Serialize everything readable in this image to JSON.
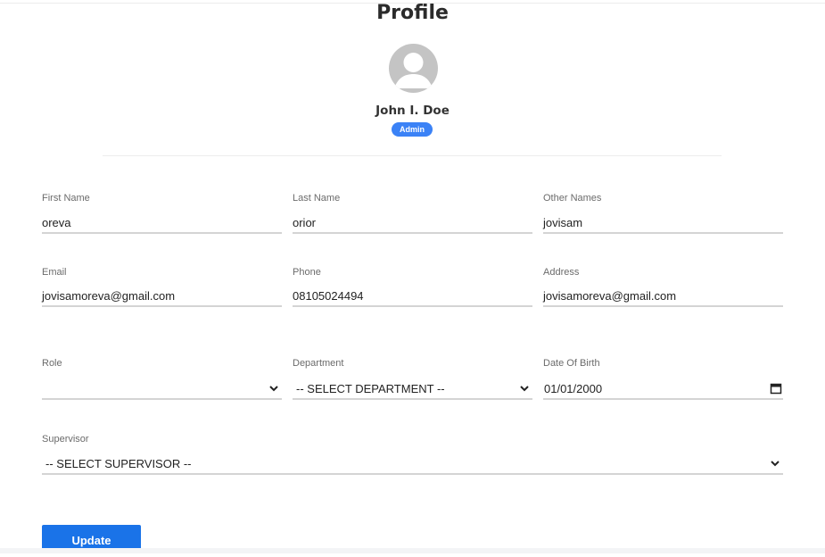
{
  "page": {
    "title": "Profile"
  },
  "profile": {
    "name": "John I. Doe",
    "role_badge": "Admin"
  },
  "form": {
    "first_name": {
      "label": "First Name",
      "value": "oreva"
    },
    "last_name": {
      "label": "Last Name",
      "value": "orior"
    },
    "other_names": {
      "label": "Other Names",
      "value": "jovisam"
    },
    "email": {
      "label": "Email",
      "value": "jovisamoreva@gmail.com"
    },
    "phone": {
      "label": "Phone",
      "value": "08105024494"
    },
    "address": {
      "label": "Address",
      "value": "jovisamoreva@gmail.com"
    },
    "role": {
      "label": "Role",
      "value": ""
    },
    "department": {
      "label": "Department",
      "value": "-- SELECT DEPARTMENT --"
    },
    "date_of_birth": {
      "label": "Date Of Birth",
      "value": "01/01/2000"
    },
    "supervisor": {
      "label": "Supervisor",
      "value": "-- SELECT SUPERVISOR --"
    }
  },
  "actions": {
    "update_label": "Update"
  },
  "icons": {
    "avatar": "default-user-icon",
    "select": "chevron-down-icon",
    "date": "calendar-icon"
  },
  "colors": {
    "accent": "#1a73e8",
    "badge": "#3b82f6"
  }
}
